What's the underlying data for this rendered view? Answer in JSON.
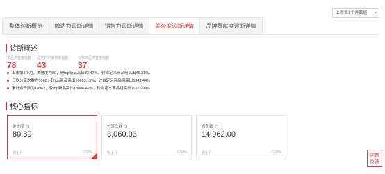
{
  "tabs": [
    {
      "label": "整体诊断概览",
      "active": false
    },
    {
      "label": "触达力诊断详情",
      "active": false
    },
    {
      "label": "销售力诊断详情",
      "active": false
    },
    {
      "label": "美誉度诊断详情",
      "active": true
    },
    {
      "label": "品牌贡献度诊断详情",
      "active": false
    }
  ],
  "period_select": {
    "value": "上新第1个月数据",
    "caret": "▾"
  },
  "overview": {
    "title": "诊断概述",
    "metrics": [
      {
        "label": "本品美誉度指数",
        "value": "78"
      },
      {
        "label": "品类TOP美誉度指数",
        "value": "43"
      },
      {
        "label": "对标商品美誉度指数",
        "value": "37"
      }
    ],
    "bullets": [
      "上市第1个月，美誉度为80，较top新品高出33.47%，较自定义商品组高出45.31%。",
      "日均分享次数为3060，较top新品高出10653.15%，较自定义商品组高出6349.44%",
      "累计点赞数为14962，较top新品高出18886.42%，较自定义商品组高出11975.99%"
    ]
  },
  "kpi": {
    "title": "核心指标",
    "cards": [
      {
        "label": "美誉度",
        "value": "80.89",
        "foot_label": "较上月",
        "foot_value": "0.00%",
        "selected": true
      },
      {
        "label": "分享次数",
        "value": "3,060.03",
        "foot_label": "较上月",
        "foot_value": "0.00%",
        "selected": false
      },
      {
        "label": "点赞数",
        "value": "14,962.00",
        "foot_label": "较上月",
        "foot_value": "0.00%",
        "selected": false
      }
    ]
  },
  "feedback": {
    "line1": "问题",
    "line2": "反馈"
  },
  "colors": {
    "accent": "#e4393c",
    "border": "#e6e6e6",
    "tab_bg": "#f3f3f3"
  }
}
